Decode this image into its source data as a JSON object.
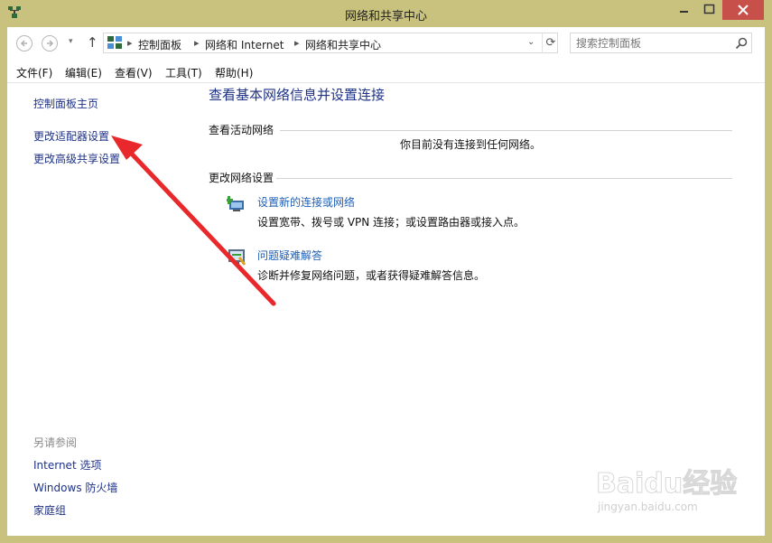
{
  "window": {
    "title": "网络和共享中心"
  },
  "address": {
    "crumbs": [
      "控制面板",
      "网络和 Internet",
      "网络和共享中心"
    ],
    "search_placeholder": "搜索控制面板"
  },
  "menu": [
    "文件(F)",
    "编辑(E)",
    "查看(V)",
    "工具(T)",
    "帮助(H)"
  ],
  "sidebar": {
    "links": [
      "控制面板主页",
      "更改适配器设置",
      "更改高级共享设置"
    ],
    "see_also_label": "另请参阅",
    "see_also": [
      "Internet 选项",
      "Windows 防火墙",
      "家庭组"
    ]
  },
  "main": {
    "title": "查看基本网络信息并设置连接",
    "active_heading": "查看活动网络",
    "active_status": "你目前没有连接到任何网络。",
    "change_heading": "更改网络设置",
    "tasks": [
      {
        "link": "设置新的连接或网络",
        "desc": "设置宽带、拨号或 VPN 连接；或设置路由器或接入点。",
        "icon": "network-setup-icon"
      },
      {
        "link": "问题疑难解答",
        "desc": "诊断并修复网络问题，或者获得疑难解答信息。",
        "icon": "troubleshoot-icon"
      }
    ]
  },
  "watermark": {
    "brand": "Baidu经验",
    "url": "jingyan.baidu.com"
  },
  "colors": {
    "frame": "#c9c27e",
    "link": "#1e3287",
    "task_link": "#1e5fb7",
    "close": "#c7504b",
    "annotation_arrow": "#e8282b"
  }
}
